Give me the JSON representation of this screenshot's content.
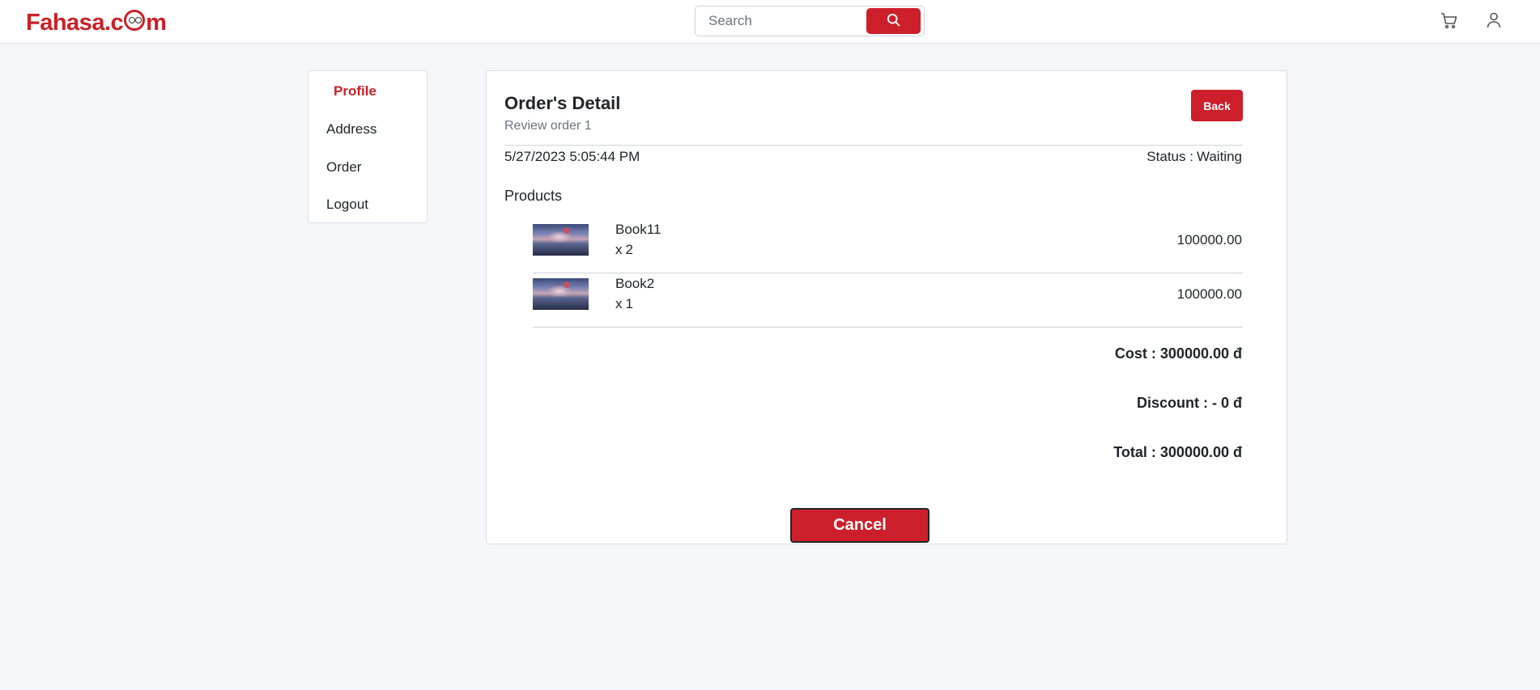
{
  "header": {
    "logo_text_1": "Fahasa.c",
    "logo_text_2": "m",
    "search": {
      "placeholder": "Search",
      "value": ""
    },
    "icons": {
      "search": "search-icon",
      "cart": "cart-icon",
      "user": "user-icon"
    }
  },
  "sidebar": {
    "items": [
      {
        "label": "Profile",
        "active": true
      },
      {
        "label": "Address",
        "active": false
      },
      {
        "label": "Order",
        "active": false
      },
      {
        "label": "Logout",
        "active": false
      }
    ]
  },
  "order": {
    "title": "Order's Detail",
    "subtitle": "Review order 1",
    "back_label": "Back",
    "date": "5/27/2023 5:05:44 PM",
    "status_label": "Status :",
    "status_value": "Waiting",
    "products_heading": "Products",
    "products": [
      {
        "name": "Book11",
        "qty_prefix": "x",
        "qty": "2",
        "price": "100000.00"
      },
      {
        "name": "Book2",
        "qty_prefix": "x",
        "qty": "1",
        "price": "100000.00"
      }
    ],
    "cost_label": "Cost :",
    "cost_value": "300000.00 đ",
    "discount_label": "Discount :",
    "discount_value": "- 0 đ",
    "total_label": "Total :",
    "total_value": "300000.00 đ",
    "cancel_label": "Cancel"
  },
  "colors": {
    "accent": "#cd1f2b",
    "brand": "#c92127",
    "background": "#f5f6fa"
  }
}
